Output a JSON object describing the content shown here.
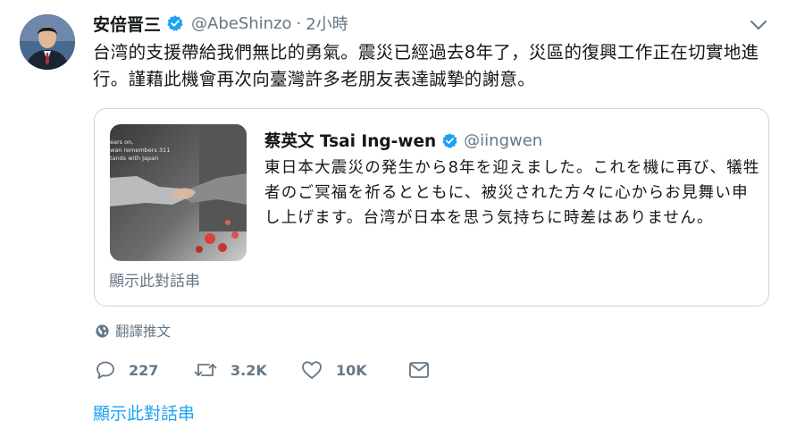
{
  "tweet": {
    "display_name": "安倍晋三",
    "handle": "@AbeShinzo",
    "separator": "·",
    "time": "2小時",
    "text": "台湾的支援帶給我們無比的勇氣。震災已經過去8年了，災區的復興工作正在切實地進行。謹藉此機會再次向臺灣許多老朋友表達誠摯的謝意。",
    "icons": {
      "verified": "verified-badge-icon",
      "menu": "chevron-down-icon"
    }
  },
  "quote": {
    "display_name": "蔡英文 Tsai Ing-wen",
    "handle": "@iingwen",
    "text": "東日本大震災の発生から8年を迎えました。これを機に再び、犠牲者のご冥福を祈るとともに、被災された方々に心からお見舞い申し上げます。台湾が日本を思う気持ちに時差はありません。",
    "image_caption_lines": [
      "ears on,",
      "wan remembers 311",
      "tands with Japan"
    ],
    "show_thread": "顯示此對話串"
  },
  "translate": {
    "label": "翻譯推文",
    "icon": "globe-icon"
  },
  "actions": {
    "reply_count": "227",
    "retweet_count": "3.2K",
    "like_count": "10K",
    "icons": [
      "reply-icon",
      "retweet-icon",
      "like-icon",
      "message-icon"
    ]
  },
  "show_thread": "顯示此對話串",
  "colors": {
    "primary_text": "#14171a",
    "secondary_text": "#657786",
    "link": "#1da1f2",
    "border": "#ccd6dd",
    "verified": "#1da1f2"
  }
}
